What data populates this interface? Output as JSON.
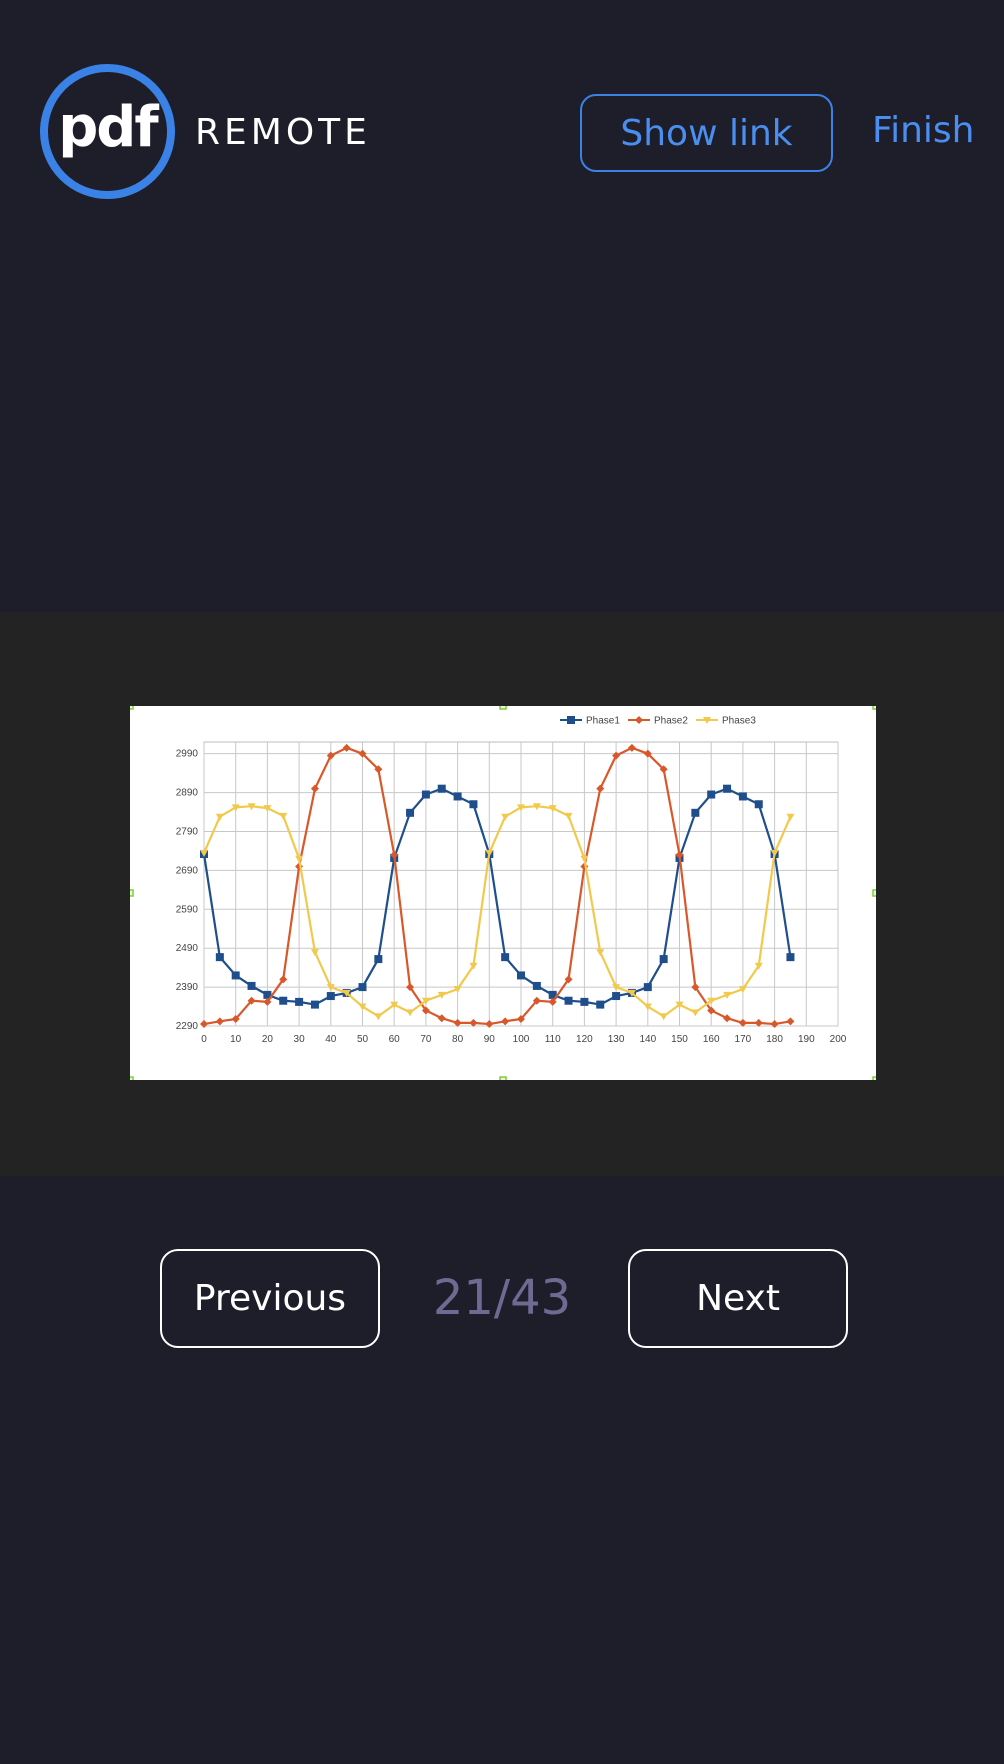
{
  "header": {
    "logo_text": "pdf",
    "brand_text": "REMOTE",
    "show_link_label": "Show link",
    "finish_label": "Finish"
  },
  "navigation": {
    "previous_label": "Previous",
    "next_label": "Next",
    "page_counter": "21/43",
    "current_page": 21,
    "total_pages": 43
  },
  "colors": {
    "background": "#1e1d2a",
    "accent": "#3b82e6",
    "stage": "#232323",
    "counter": "#6e6a92"
  },
  "chart_data": {
    "type": "line",
    "title": "",
    "xlabel": "",
    "ylabel": "",
    "xlim": [
      0,
      200
    ],
    "ylim": [
      2290,
      3020
    ],
    "x_ticks": [
      0,
      10,
      20,
      30,
      40,
      50,
      60,
      70,
      80,
      90,
      100,
      110,
      120,
      130,
      140,
      150,
      160,
      170,
      180,
      190,
      200
    ],
    "y_ticks": [
      2290,
      2390,
      2490,
      2590,
      2690,
      2790,
      2890,
      2990
    ],
    "grid": true,
    "legend": "top-right",
    "x": [
      0,
      5,
      10,
      15,
      20,
      25,
      30,
      35,
      40,
      45,
      50,
      55,
      60,
      65,
      70,
      75,
      80,
      85,
      90,
      95,
      100,
      105,
      110,
      115,
      120,
      125,
      130,
      135,
      140,
      145,
      150,
      155,
      160,
      165,
      170,
      175,
      180,
      185
    ],
    "series": [
      {
        "name": "Phase1",
        "color": "#1f4e8c",
        "marker": "square",
        "values": [
          2732,
          2467,
          2420,
          2393,
          2370,
          2355,
          2352,
          2345,
          2367,
          2375,
          2390,
          2462,
          2722,
          2838,
          2885,
          2900,
          2880,
          2860,
          2732,
          2467,
          2420,
          2393,
          2370,
          2355,
          2352,
          2345,
          2367,
          2375,
          2390,
          2462,
          2722,
          2838,
          2885,
          2900,
          2880,
          2860,
          2732,
          2467
        ]
      },
      {
        "name": "Phase2",
        "color": "#d9582b",
        "marker": "diamond",
        "values": [
          2295,
          2302,
          2308,
          2355,
          2352,
          2410,
          2700,
          2900,
          2985,
          3005,
          2990,
          2950,
          2730,
          2390,
          2330,
          2310,
          2298,
          2298,
          2295,
          2302,
          2308,
          2355,
          2352,
          2410,
          2700,
          2900,
          2985,
          3005,
          2990,
          2950,
          2730,
          2390,
          2330,
          2310,
          2298,
          2298,
          2295,
          2302
        ]
      },
      {
        "name": "Phase3",
        "color": "#f2c94c",
        "marker": "triangle",
        "values": [
          2735,
          2828,
          2852,
          2855,
          2850,
          2830,
          2720,
          2480,
          2390,
          2375,
          2340,
          2315,
          2345,
          2325,
          2355,
          2370,
          2385,
          2445,
          2735,
          2828,
          2852,
          2855,
          2850,
          2830,
          2720,
          2480,
          2390,
          2375,
          2340,
          2315,
          2345,
          2325,
          2355,
          2370,
          2385,
          2445,
          2735,
          2828
        ]
      }
    ]
  }
}
